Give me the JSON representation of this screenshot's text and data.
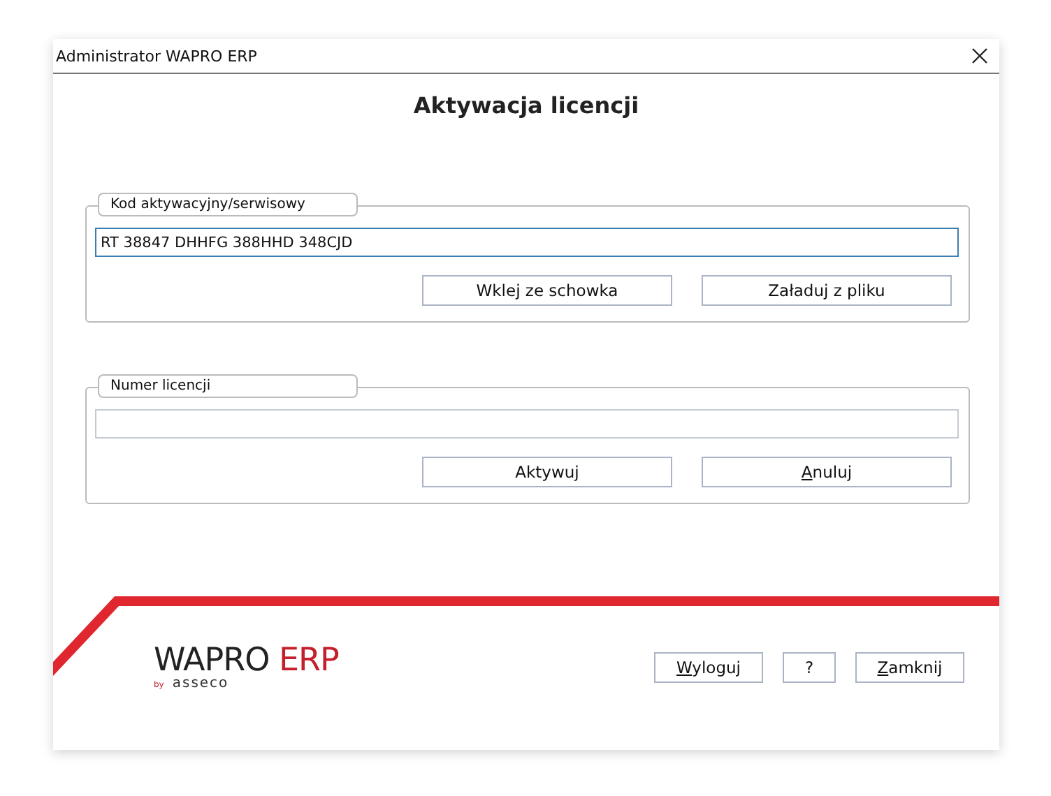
{
  "window": {
    "title": "Administrator WAPRO ERP"
  },
  "heading": "Aktywacja licencji",
  "groups": [
    {
      "legend": "Kod aktywacyjny/serwisowy",
      "field": {
        "value": "RT 38847 DHHFG 388HHD 348CJD",
        "focused": true
      },
      "buttons": [
        {
          "label": "Wklej ze schowka",
          "mnemonic": false
        },
        {
          "label": "Załaduj z pliku",
          "mnemonic": false
        }
      ]
    },
    {
      "legend": "Numer licencji",
      "field": {
        "focused": false
      },
      "buttons": [
        {
          "label": "Aktywuj",
          "mnemonic": false
        },
        {
          "label": "Anuluj",
          "mnemonic": true
        }
      ]
    }
  ],
  "logo": {
    "name": "WAPRO",
    "accent": "ERP",
    "by": "by",
    "brand": "asseco"
  },
  "footer_buttons": [
    {
      "label": "Wyloguj",
      "mnemonic": true
    },
    {
      "label": "?",
      "mnemonic": false
    },
    {
      "label": "Zamknij",
      "mnemonic": true
    }
  ]
}
